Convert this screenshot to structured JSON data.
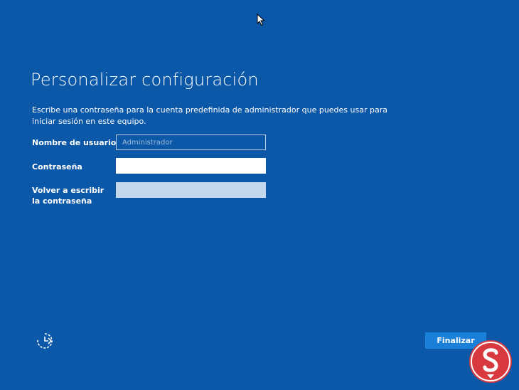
{
  "page": {
    "title": "Personalizar configuración",
    "description": "Escribe una contraseña para la cuenta predefinida de administrador que puedes usar para iniciar sesión en este equipo."
  },
  "form": {
    "username": {
      "label": "Nombre de usuario",
      "placeholder": "Administrador",
      "value": ""
    },
    "password": {
      "label": "Contraseña",
      "value": ""
    },
    "confirm_password": {
      "label": "Volver a escribir la contraseña",
      "value": ""
    }
  },
  "buttons": {
    "finish_label": "Finalizar"
  },
  "icons": {
    "ease_of_access": "ease-of-access-icon",
    "cursor": "mouse-cursor-icon",
    "watermark": "site-logo-icon"
  },
  "colors": {
    "background": "#0b58a8",
    "button": "#1a7fd9",
    "disabled_field": "#c5d7ea",
    "watermark_red": "#d7393f"
  }
}
